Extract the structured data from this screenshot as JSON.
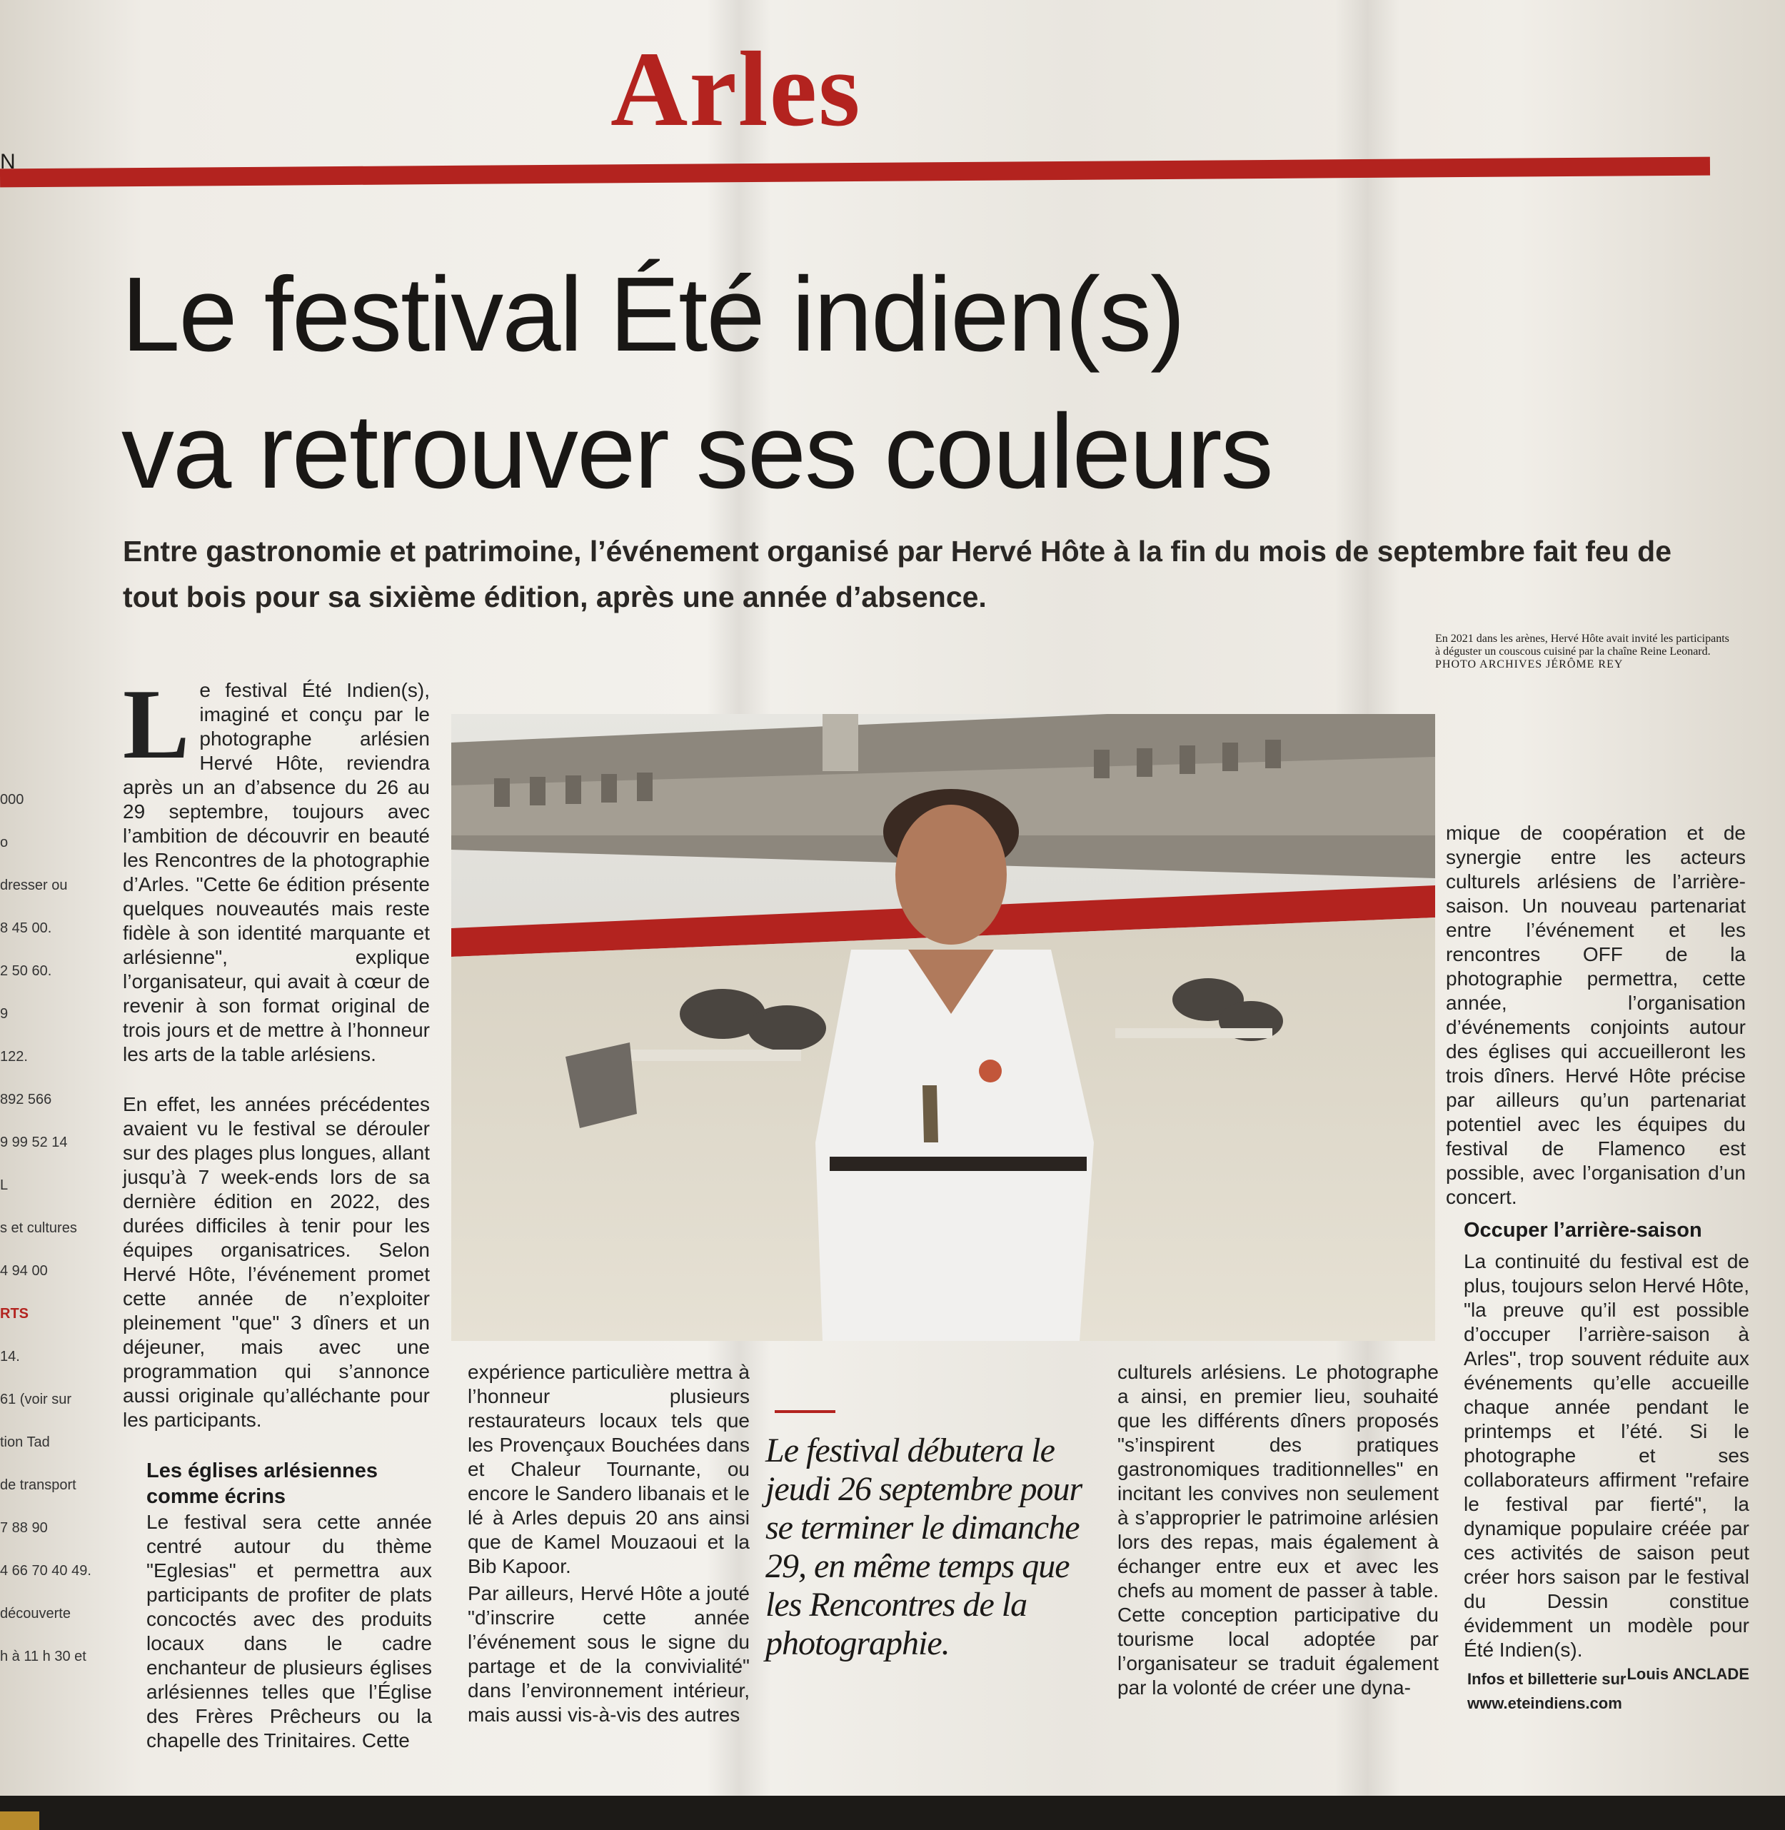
{
  "page": {
    "section": "Arles",
    "headline_line1": "Le festival Été indien(s)",
    "headline_line2": "va retrouver ses couleurs",
    "standfirst": "Entre gastronomie et patrimoine, l’événement organisé par Hervé Hôte à la fin du mois de septembre fait feu de tout bois pour sa sixième édition, après une année d’absence.",
    "rule_margin": "N"
  },
  "article": {
    "dropcap": "L",
    "col1_p1": "e festival Été Indien(s), imaginé et conçu par le photographe arlésien Hervé Hôte, reviendra après un an d’absence du 26 au 29 septembre, toujours avec l’ambition de découvrir en beauté les Rencontres de la photographie d’Arles. \"Cette 6e édition présente quelques nouveautés mais reste fidèle à son identité marquante et arlésienne\", explique l’organisateur, qui avait à cœur de revenir à son format original de trois jours et de mettre à l’honneur les arts de la table arlésiens.",
    "col1_p2": "En effet, les années précédentes avaient vu le festival se dérouler sur des plages plus longues, allant jusqu’à 7 week-ends lors de sa dernière édition en 2022, des durées difficiles à tenir pour les équipes organisatrices. Selon Hervé Hôte, l’événement promet cette année de n’exploiter pleinement \"que\" 3 dîners et un déjeuner, mais avec une programmation qui s’annonce aussi originale qu’alléchante pour les participants.",
    "col1_subhead": "Les églises arlésiennes comme écrins",
    "col1_p3": "Le festival sera cette année centré autour du thème \"Eglesias\" et permettra aux participants de profiter de plats concoctés avec des produits locaux dans le cadre enchanteur de plusieurs églises arlésiennes telles que l’Église des Frères Prêcheurs ou la chapelle des Trinitaires. Cette",
    "col2_p1": "expérience particulière mettra à l’honneur plusieurs restaurateurs locaux tels que les Provençaux Bouchées dans et Chaleur Tournante, ou encore le Sandero libanais et le lé à Arles depuis 20 ans ainsi que de Kamel Mouzaoui et la Bib Kapoor.",
    "col2_p2": "Par ailleurs, Hervé Hôte a jouté \"d’inscrire cette année l’événement sous le signe du partage et de la convivialité\" dans l’environnement intérieur, mais aussi vis-à-vis des autres",
    "col3_p1": "culturels arlésiens. Le photographe a ainsi, en premier lieu, souhaité que les différents dîners proposés \"s’inspirent des pratiques gastronomiques traditionnelles\" en incitant les convives non seulement à s’approprier le patrimoine arlésien lors des repas, mais également à échanger entre eux et avec les chefs au moment de passer à table. Cette conception participative du tourisme local adoptée par l’organisateur se traduit également par la volonté de créer une dyna-",
    "col4_p1": "mique de coopération et de synergie entre les acteurs culturels arlésiens de l’arrière-saison. Un nouveau partenariat entre l’événement et les rencontres OFF de la photographie permettra, cette année, l’organisation d’événements conjoints autour des églises qui accueilleront les trois dîners. Hervé Hôte précise par ailleurs qu’un partenariat potentiel avec les équipes du festival de Flamenco est possible, avec l’organisation d’un concert.",
    "col4_subhead": "Occuper l’arrière-saison",
    "col4_p2": "La continuité du festival est de plus, toujours selon Hervé Hôte, \"la preuve qu’il est possible d’occuper l’arrière-saison à Arles\", trop souvent réduite aux événements qu’elle accueille chaque année pendant le printemps et l’été. Si le photographe et ses collaborateurs affirment \"refaire le festival par fierté\", la dynamique populaire créée par ces activités de saison peut créer hors saison par le festival du Dessin constitue évidemment un modèle pour Été Indien(s).",
    "signature": "Louis ANCLADE",
    "info": "Infos et billetterie sur www.eteindiens.com"
  },
  "photo": {
    "caption": "En 2021 dans les arènes, Hervé Hôte avait invité les participants à déguster un couscous cuisiné par la chaîne Reine Leonard.",
    "credit": "PHOTO ARCHIVES JÉRÔME REY"
  },
  "pullquote": "Le festival débutera le jeudi 26 septembre pour se terminer le dimanche 29, en même temps que les Rencontres de la photographie.",
  "left_margin": [
    "000",
    "o",
    "dresser ou",
    "8 45 00.",
    "2 50 60.",
    "9",
    "122.",
    "892 566",
    "9 99 52 14",
    "L",
    "s et cultures",
    "4 94 00",
    "RTS",
    "14.",
    "61 (voir sur",
    "tion Tad",
    "de transport",
    "7 88 90",
    "4 66 70 40 49.",
    "découverte",
    "h à 11 h 30 et"
  ],
  "colors": {
    "accent_red": "#b3231f",
    "paper": "#efece6",
    "ink": "#1d1b19"
  }
}
